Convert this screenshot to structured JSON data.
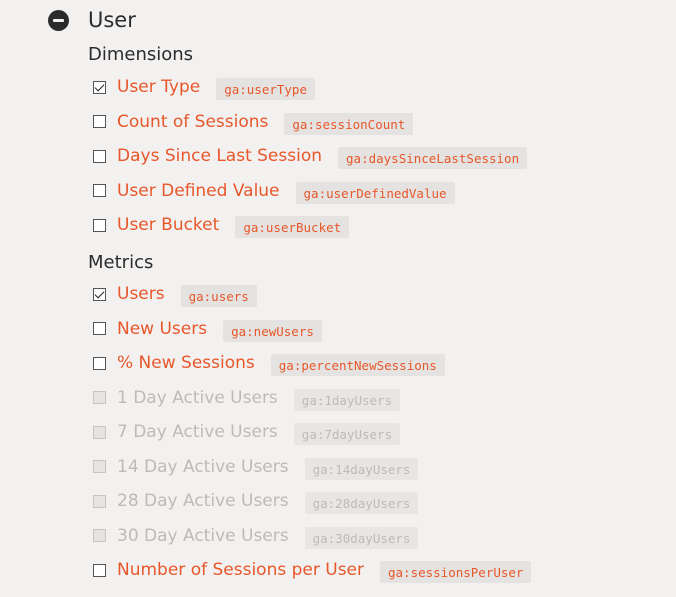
{
  "header": {
    "title": "User",
    "icon": "minus-circle-icon"
  },
  "dimensions": {
    "title": "Dimensions",
    "items": [
      {
        "label": "User Type",
        "code": "ga:userType",
        "checked": true,
        "disabled": false
      },
      {
        "label": "Count of Sessions",
        "code": "ga:sessionCount",
        "checked": false,
        "disabled": false
      },
      {
        "label": "Days Since Last Session",
        "code": "ga:daysSinceLastSession",
        "checked": false,
        "disabled": false
      },
      {
        "label": "User Defined Value",
        "code": "ga:userDefinedValue",
        "checked": false,
        "disabled": false
      },
      {
        "label": "User Bucket",
        "code": "ga:userBucket",
        "checked": false,
        "disabled": false
      }
    ]
  },
  "metrics": {
    "title": "Metrics",
    "items": [
      {
        "label": "Users",
        "code": "ga:users",
        "checked": true,
        "disabled": false
      },
      {
        "label": "New Users",
        "code": "ga:newUsers",
        "checked": false,
        "disabled": false
      },
      {
        "label": "% New Sessions",
        "code": "ga:percentNewSessions",
        "checked": false,
        "disabled": false
      },
      {
        "label": "1 Day Active Users",
        "code": "ga:1dayUsers",
        "checked": false,
        "disabled": true
      },
      {
        "label": "7 Day Active Users",
        "code": "ga:7dayUsers",
        "checked": false,
        "disabled": true
      },
      {
        "label": "14 Day Active Users",
        "code": "ga:14dayUsers",
        "checked": false,
        "disabled": true
      },
      {
        "label": "28 Day Active Users",
        "code": "ga:28dayUsers",
        "checked": false,
        "disabled": true
      },
      {
        "label": "30 Day Active Users",
        "code": "ga:30dayUsers",
        "checked": false,
        "disabled": true
      },
      {
        "label": "Number of Sessions per User",
        "code": "ga:sessionsPerUser",
        "checked": false,
        "disabled": false
      }
    ]
  }
}
